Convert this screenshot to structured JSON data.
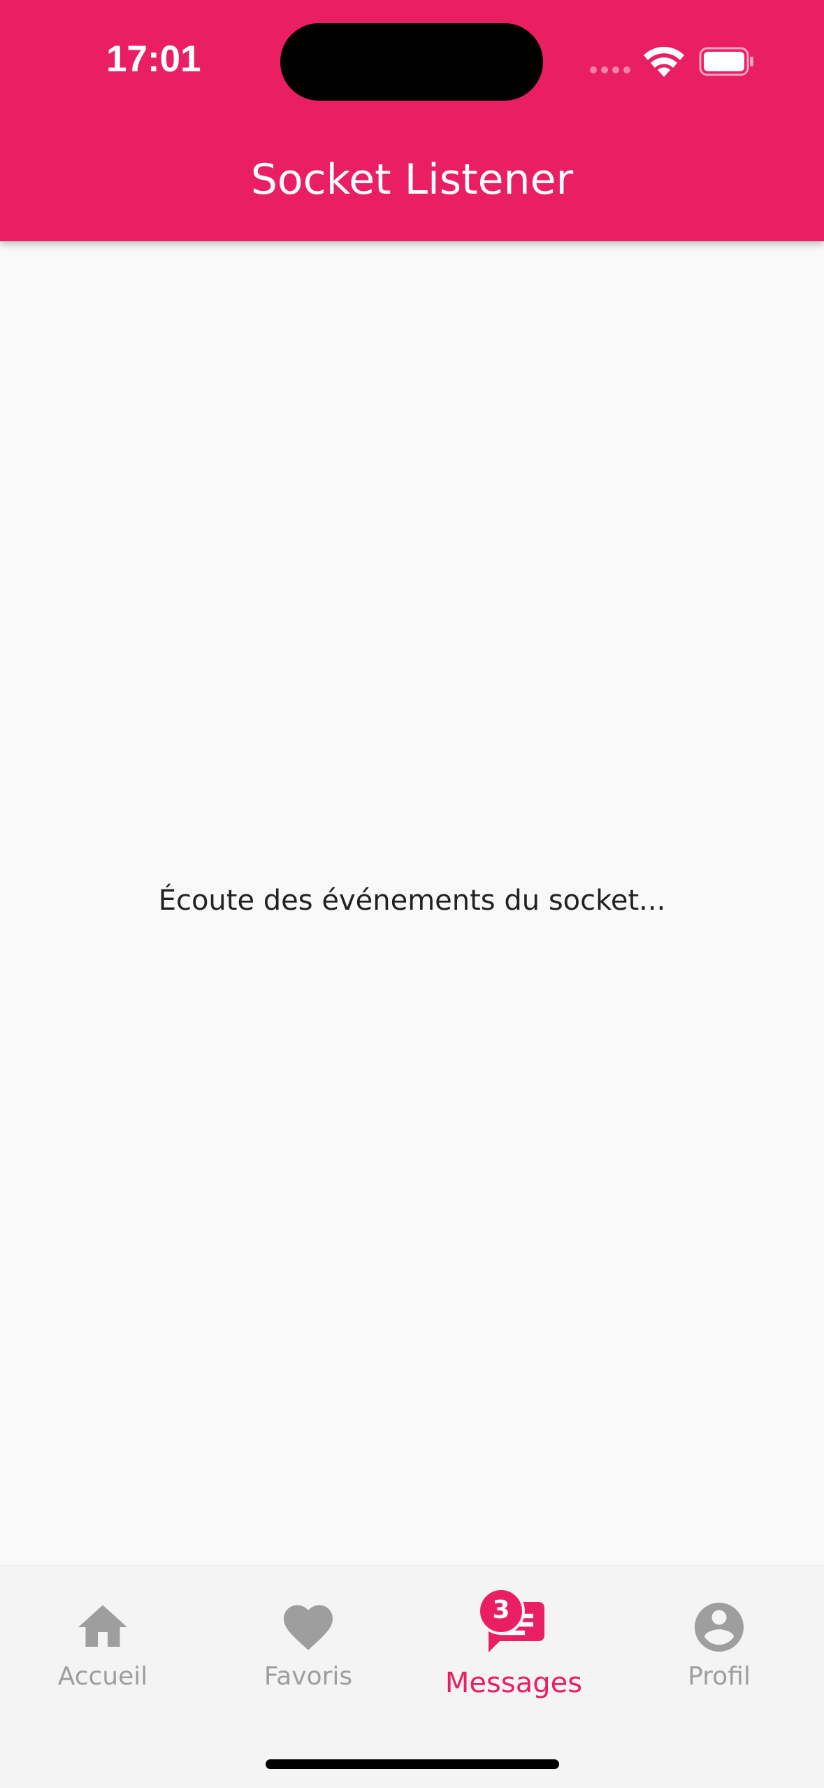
{
  "status_bar": {
    "time": "17:01"
  },
  "app_bar": {
    "title": "Socket Listener"
  },
  "main": {
    "message": "Écoute des événements du socket..."
  },
  "bottom_nav": {
    "items": [
      {
        "label": "Accueil",
        "icon": "home-icon",
        "active": false
      },
      {
        "label": "Favoris",
        "icon": "heart-icon",
        "active": false
      },
      {
        "label": "Messages",
        "icon": "message-icon",
        "active": true,
        "badge": "3"
      },
      {
        "label": "Profil",
        "icon": "account-icon",
        "active": false
      }
    ]
  },
  "colors": {
    "primary": "#ea1f63",
    "inactive": "#9e9e9e",
    "background": "#f9f9f9",
    "nav_background": "#f4f4f4"
  }
}
